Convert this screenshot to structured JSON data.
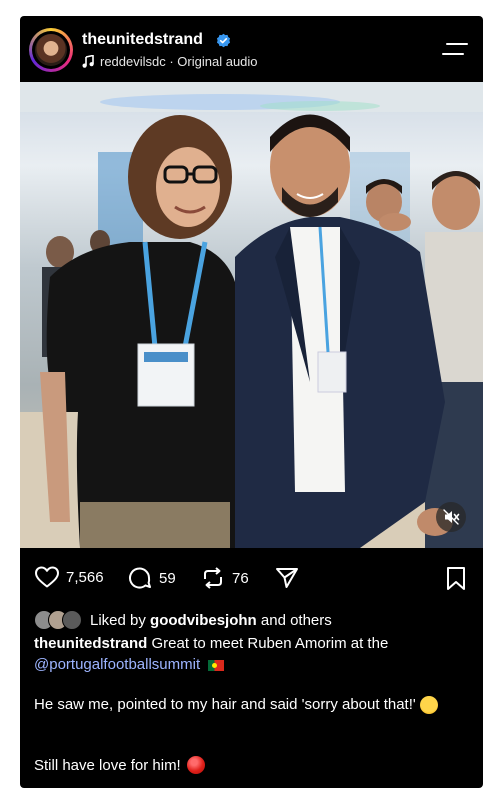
{
  "header": {
    "username": "theunitedstrand",
    "audio_text": "reddevilsdc · Original audio"
  },
  "actions": {
    "likes": "7,566",
    "comments": "59",
    "reposts": "76"
  },
  "liked_by": {
    "prefix": "Liked by ",
    "user": "goodvibesjohn",
    "suffix": " and others"
  },
  "caption": {
    "author": "theunitedstrand",
    "text": " Great to meet Ruben Amorim at the",
    "mention": "@portugalfootballsummit",
    "line2": "He saw me, pointed to my hair and said 'sorry about that!'",
    "line3": "Still have love for him!"
  },
  "colors": {
    "background": "#000000",
    "mention": "#9db4ff",
    "verified": "#3897f0"
  }
}
